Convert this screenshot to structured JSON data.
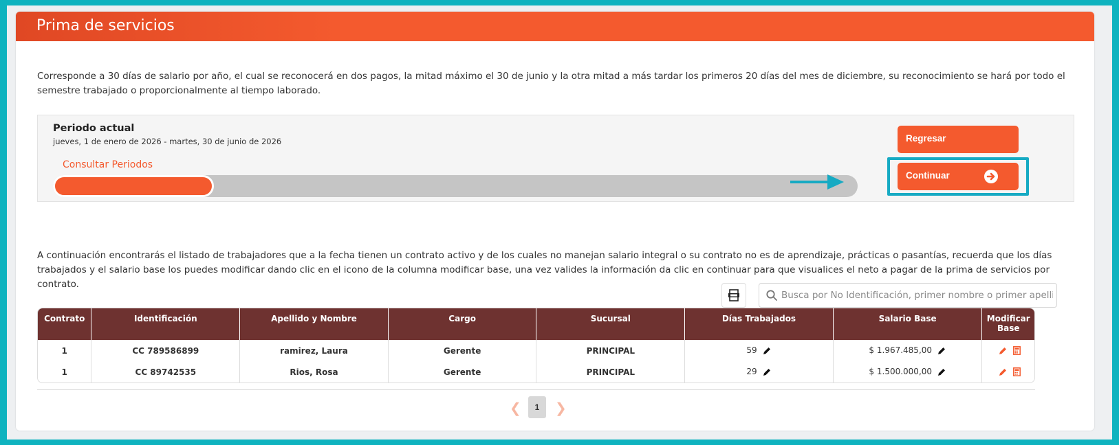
{
  "page": {
    "title": "Prima de servicios",
    "description": "Corresponde a 30 días de salario por año, el cual se reconocerá en dos pagos, la mitad máximo el 30 de junio y la otra mitad a más tardar los primeros 20 días del mes de diciembre, su reconocimiento se hará por todo el semestre trabajado o proporcionalmente al tiempo laborado."
  },
  "period": {
    "title": "Periodo actual",
    "dates": "jueves, 1 de enero de 2026 - martes, 30 de junio de 2026",
    "consult_link": "Consultar Periodos",
    "progress_fraction": 0.2
  },
  "buttons": {
    "back": "Regresar",
    "continue": "Continuar"
  },
  "list_intro": "A continuación encontrarás el listado de trabajadores que a la fecha tienen un contrato activo y de los cuales no manejan salario integral o su contrato no es de aprendizaje, prácticas o pasantías, recuerda que los días trabajados y el salario base los puedes modificar dando clic en el icono de la columna modificar base, una vez valides la información da clic en continuar para que visualices el neto a pagar de la prima de servicios por contrato.",
  "search": {
    "placeholder": "Busca por No Identificación, primer nombre o primer apellido",
    "value": ""
  },
  "table": {
    "headers": [
      "Contrato",
      "Identificación",
      "Apellido y Nombre",
      "Cargo",
      "Sucursal",
      "Días Trabajados",
      "Salario Base",
      "Modificar Base"
    ],
    "rows": [
      {
        "contrato": "1",
        "identificacion": "CC 789586899",
        "nombre": "ramirez, Laura",
        "cargo": "Gerente",
        "sucursal": "PRINCIPAL",
        "dias": "59",
        "salario": "$ 1.967.485,00"
      },
      {
        "contrato": "1",
        "identificacion": "CC 89742535",
        "nombre": "Rios, Rosa",
        "cargo": "Gerente",
        "sucursal": "PRINCIPAL",
        "dias": "29",
        "salario": "$ 1.500.000,00"
      }
    ]
  },
  "pagination": {
    "current_page": "1"
  },
  "colors": {
    "accent": "#f45a2e",
    "table_header": "#6e3230",
    "highlight": "#16aac3",
    "background": "#0fb3bf"
  },
  "icons": [
    "arrow-right-circle-icon",
    "export-excel-icon",
    "search-icon",
    "pencil-icon",
    "calculator-icon",
    "chevron-left-icon",
    "chevron-right-icon",
    "arrow-pointer-icon"
  ]
}
